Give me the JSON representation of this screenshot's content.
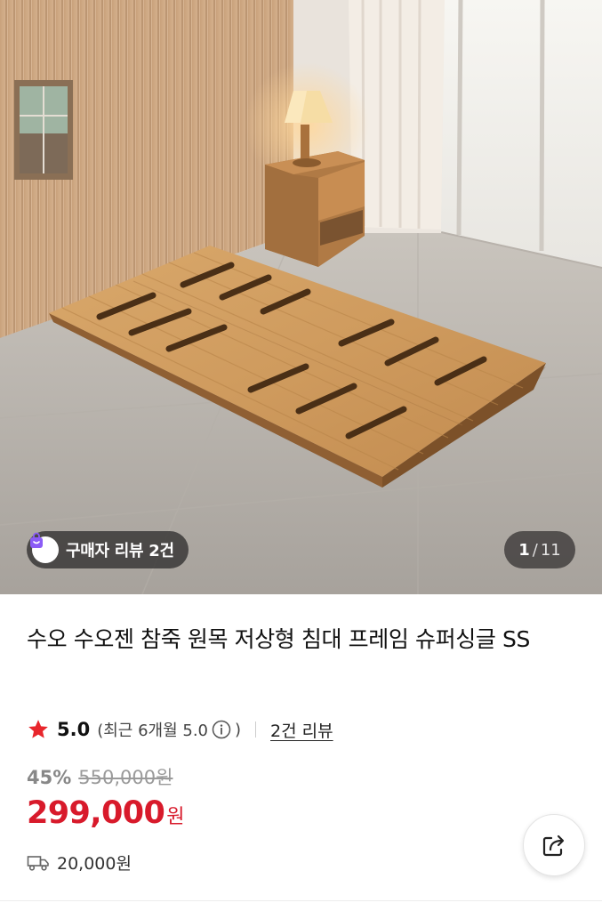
{
  "gallery": {
    "review_badge": "구매자 리뷰 2건",
    "current_page": "1",
    "separator": "/",
    "total_pages": "11"
  },
  "product": {
    "title": "수오 수오젠 참죽 원목 저상형 침대 프레임 슈퍼싱글 SS",
    "rating": {
      "score": "5.0",
      "recent_open": "(최근 6개월 5.0",
      "recent_close": ")",
      "review_link": "2건 리뷰"
    },
    "discount_percent": "45%",
    "original_price": "550,000원",
    "sale_price": "299,000",
    "currency": "원",
    "shipping_fee": "20,000원"
  },
  "colors": {
    "accent_red": "#d81a2b",
    "star": "#e8262c",
    "review_badge_icon": "#8b5cf6"
  },
  "icons": {
    "review_badge": "shopping-bag-icon",
    "rating": "star-icon",
    "info": "info-icon",
    "shipping": "truck-icon",
    "share": "share-icon"
  }
}
